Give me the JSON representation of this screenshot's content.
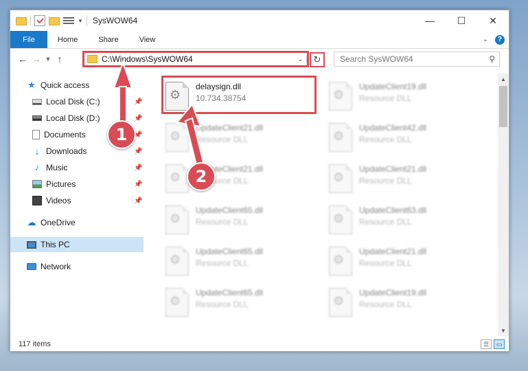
{
  "window": {
    "title": "SysWOW64",
    "controls": [
      "—",
      "☐",
      "✕"
    ]
  },
  "ribbon": {
    "tabs": [
      "File",
      "Home",
      "Share",
      "View"
    ]
  },
  "nav": {
    "address": "C:\\Windows\\SysWOW64",
    "search_placeholder": "Search SysWOW64"
  },
  "sidebar": {
    "items": [
      {
        "label": "Quick access",
        "icon": "star-icon"
      },
      {
        "label": "Local Disk (C:)",
        "icon": "disk-icon",
        "pinned": true
      },
      {
        "label": "Local Disk (D:)",
        "icon": "disk-icon",
        "pinned": true
      },
      {
        "label": "Documents",
        "icon": "documents-icon",
        "pinned": true
      },
      {
        "label": "Downloads",
        "icon": "download-icon",
        "pinned": true
      },
      {
        "label": "Music",
        "icon": "music-icon",
        "pinned": true
      },
      {
        "label": "Pictures",
        "icon": "pictures-icon",
        "pinned": true
      },
      {
        "label": "Videos",
        "icon": "video-icon",
        "pinned": true
      },
      {
        "label": "OneDrive",
        "icon": "cloud-icon"
      },
      {
        "label": "This PC",
        "icon": "pc-icon",
        "selected": true
      },
      {
        "label": "Network",
        "icon": "network-icon"
      }
    ]
  },
  "files": [
    {
      "name": "delaysign.dll",
      "sub": "10.734.38754"
    },
    {
      "name": "UpdateClient19.dll",
      "sub": "Resource DLL"
    },
    {
      "name": "UpdateClient21.dll",
      "sub": "Resource DLL"
    },
    {
      "name": "UpdateClient42.dll",
      "sub": "Resource DLL"
    },
    {
      "name": "UpdateClient21.dll",
      "sub": "Resource DLL"
    },
    {
      "name": "UpdateClient21.dll",
      "sub": "Resource DLL"
    },
    {
      "name": "UpdateClient65.dll",
      "sub": "Resource DLL"
    },
    {
      "name": "UpdateClient63.dll",
      "sub": "Resource DLL"
    },
    {
      "name": "UpdateClient65.dll",
      "sub": "Resource DLL"
    },
    {
      "name": "UpdateClient21.dll",
      "sub": "Resource DLL"
    },
    {
      "name": "UpdateClient65.dll",
      "sub": "Resource DLL"
    },
    {
      "name": "UpdateClient19.dll",
      "sub": "Resource DLL"
    }
  ],
  "status": {
    "count": "117 items"
  },
  "annotations": {
    "step1": "1",
    "step2": "2",
    "color": "#d94b55"
  }
}
